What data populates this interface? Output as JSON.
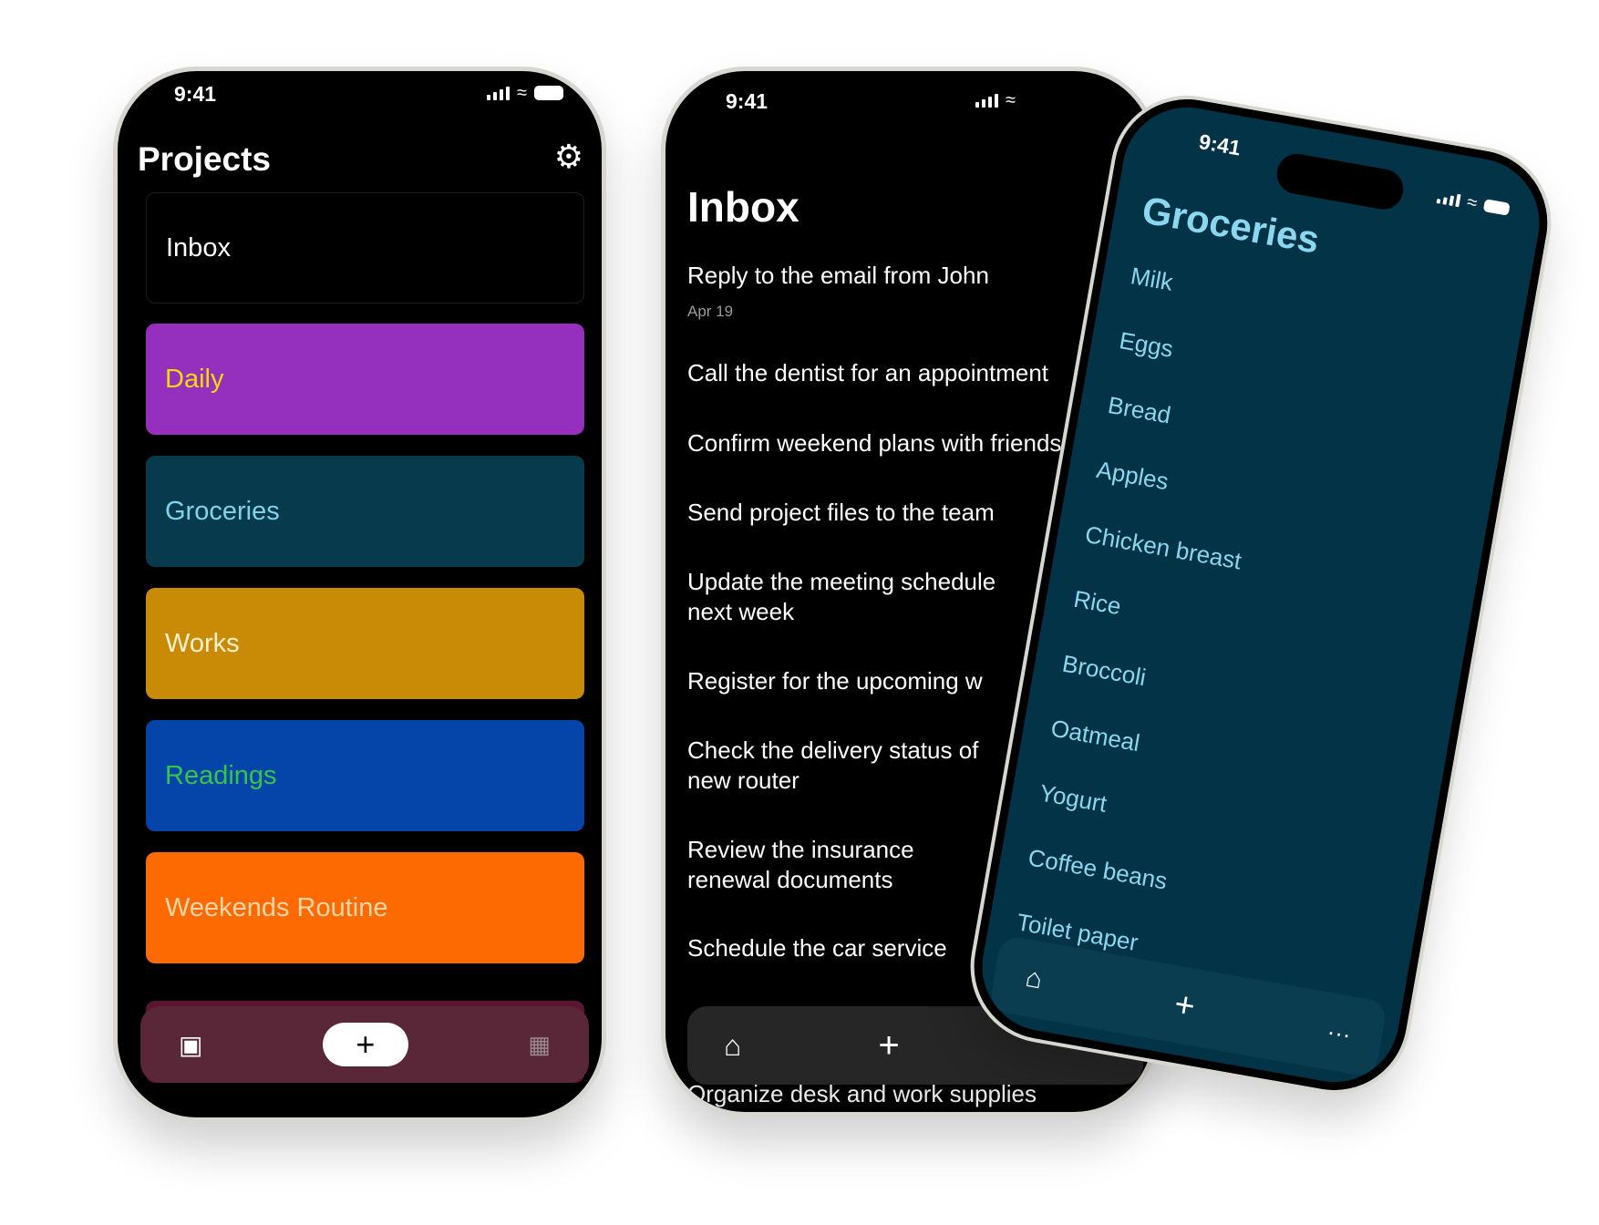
{
  "projects_screen": {
    "time": "9:41",
    "title": "Projects",
    "settings_icon": "gear-icon",
    "projects": [
      {
        "label": "Inbox",
        "bg": "#000000",
        "fg": "#ffffff"
      },
      {
        "label": "Daily",
        "bg": "#9430bd",
        "fg": "#f5d90a"
      },
      {
        "label": "Groceries",
        "bg": "#073a4c",
        "fg": "#7fd4ea"
      },
      {
        "label": "Works",
        "bg": "#c98a06",
        "fg": "#fff2cc"
      },
      {
        "label": "Readings",
        "bg": "#0544a8",
        "fg": "#35c44d"
      },
      {
        "label": "Weekends Routine",
        "bg": "#fd6a02",
        "fg": "#ffd6a6"
      }
    ],
    "tabbar": {
      "left_icon": "inbox-tray-icon",
      "center_icon": "plus-icon",
      "right_icon": "calendar-icon",
      "bg": "#5a2738"
    }
  },
  "inbox_screen": {
    "time": "9:41",
    "title": "Inbox",
    "tasks": [
      {
        "text": "Reply to the email from John",
        "date": "Apr 19"
      },
      {
        "text": "Call the dentist for an appointment"
      },
      {
        "text": "Confirm weekend plans with friends"
      },
      {
        "text": "Send project files to the team"
      },
      {
        "text": "Update the meeting schedule",
        "text2": "next week"
      },
      {
        "text": "Register for the upcoming w"
      },
      {
        "text": "Check the delivery status of",
        "text2": "new router"
      },
      {
        "text": "Review the insurance",
        "text2": "renewal documents"
      },
      {
        "text": "Schedule the car service"
      },
      {
        "text": "Organize desk and work supplies"
      }
    ],
    "tabbar": {
      "left_icon": "home-icon",
      "center_icon": "plus-icon"
    }
  },
  "groceries_screen": {
    "time": "9:41",
    "title": "Groceries",
    "items": [
      "Milk",
      "Eggs",
      "Bread",
      "Apples",
      "Chicken breast",
      "Rice",
      "Broccoli",
      "Oatmeal",
      "Yogurt",
      "Coffee beans",
      "Toilet paper"
    ],
    "tabbar": {
      "left_icon": "home-icon",
      "center_icon": "plus-icon",
      "right_icon": "more-icon"
    },
    "bg": "#033347",
    "fg": "#8ad8ef"
  }
}
